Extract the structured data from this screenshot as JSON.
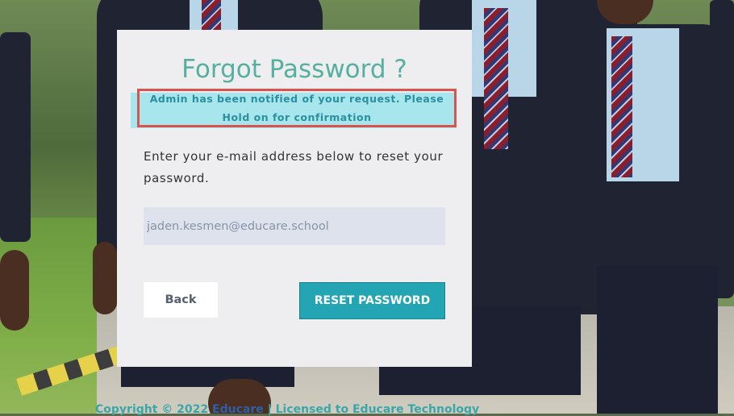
{
  "form": {
    "title": "Forgot Password ?",
    "notice": "Admin has been notified of your request. Please Hold on for confirmation",
    "instructions": "Enter your e-mail address below to reset your password.",
    "email_value": "jaden.kesmen@educare.school",
    "back_label": "Back",
    "reset_label": "RESET PASSWORD"
  },
  "footer": {
    "copyright": "Copyright © 2022",
    "link": "Educare",
    "separator": "|",
    "licensed": "Licensed to Educare Technology"
  },
  "colors": {
    "title": "#56b0a0",
    "notice_bg": "#a8e6ee",
    "notice_border": "#d9534f",
    "primary_button": "#23a5b3"
  }
}
